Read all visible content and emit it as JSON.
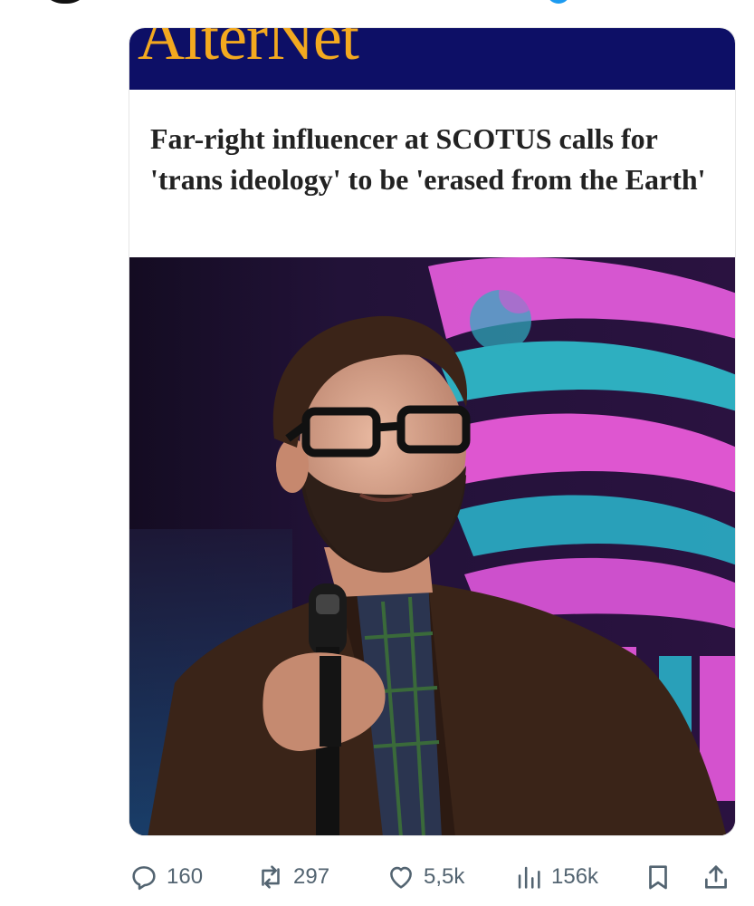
{
  "card": {
    "brand": "AlterNet",
    "headline": "Far-right influencer at SCOTUS calls for 'trans ideology' to be 'erased from the Earth'",
    "brand_color": "#0d0f66",
    "logo_color": "#f3a91f"
  },
  "actions": {
    "replies": "160",
    "reposts": "297",
    "likes": "5,5k",
    "views": "156k"
  },
  "icons": [
    "reply-icon",
    "repost-icon",
    "like-icon",
    "views-icon",
    "bookmark-icon",
    "share-icon"
  ],
  "colors": {
    "action_gray": "#536471",
    "verified_blue": "#1d9bf0"
  }
}
